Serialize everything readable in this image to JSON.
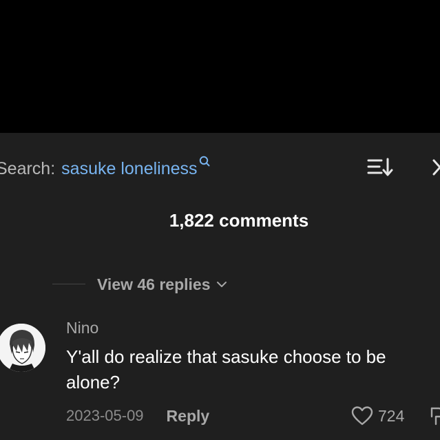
{
  "header": {
    "search_prefix": "Search:",
    "search_term": "sasuke loneliness"
  },
  "comments": {
    "count_label": "1,822 comments",
    "view_replies_label": "View 46 replies"
  },
  "comment": {
    "username": "Nino",
    "text": "Y'all do realize that sasuke choose to be alone?",
    "date": "2023-05-09",
    "reply_label": "Reply",
    "like_count": "724"
  },
  "colors": {
    "sheet_background": "#1f1f1f",
    "search_link": "#78b4f0",
    "primary_text": "#ffffff",
    "secondary_text": "#a8a8a8"
  },
  "icons": {
    "search": "search-icon",
    "sort": "sort-icon",
    "close": "close-icon",
    "chevron": "chevron-down-icon",
    "like": "heart-icon",
    "dislike": "dislike-icon"
  }
}
